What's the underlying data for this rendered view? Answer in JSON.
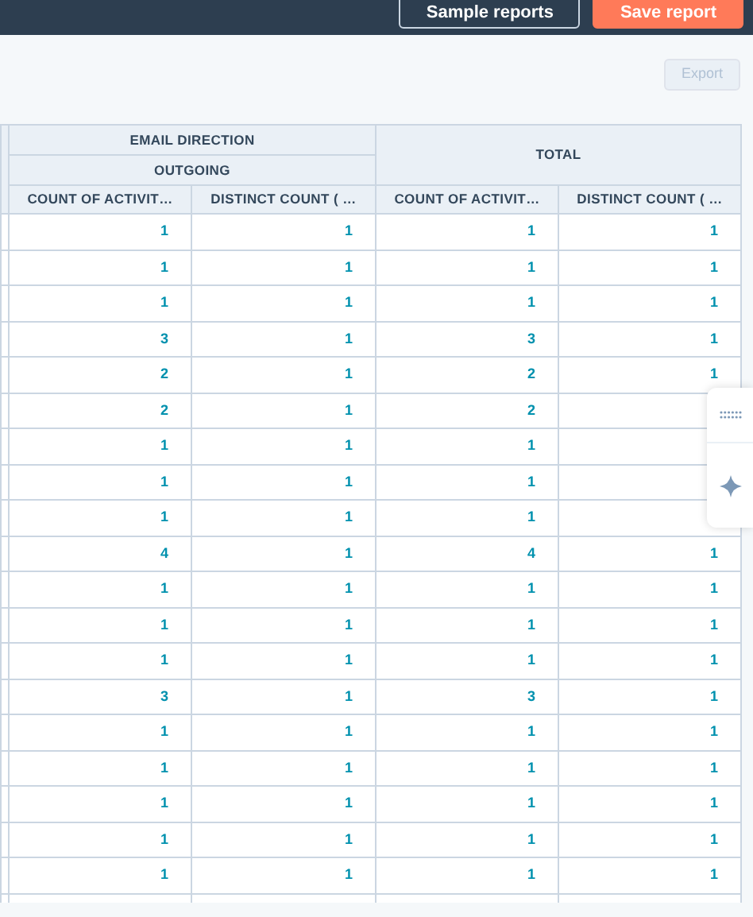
{
  "top_bar": {
    "buttons": [
      {
        "label": "Sample reports",
        "kind": "secondary"
      },
      {
        "label": "Save report",
        "kind": "primary"
      }
    ]
  },
  "export_button": {
    "label": "Export",
    "disabled": true
  },
  "table": {
    "group_header": "EMAIL DIRECTION",
    "sub_header": "OUTGOING",
    "total_header": "TOTAL",
    "columns": [
      "COUNT OF ACTIVIT…",
      "DISTINCT COUNT ( …",
      "COUNT OF ACTIVIT…",
      "DISTINCT COUNT ( …"
    ],
    "rows": [
      [
        "1",
        "1",
        "1",
        "1"
      ],
      [
        "1",
        "1",
        "1",
        "1"
      ],
      [
        "1",
        "1",
        "1",
        "1"
      ],
      [
        "3",
        "1",
        "3",
        "1"
      ],
      [
        "2",
        "1",
        "2",
        "1"
      ],
      [
        "2",
        "1",
        "2"
      ],
      [
        "1",
        "1",
        "1"
      ],
      [
        "1",
        "1",
        "1"
      ],
      [
        "1",
        "1",
        "1"
      ],
      [
        "4",
        "1",
        "4",
        "1"
      ],
      [
        "1",
        "1",
        "1",
        "1"
      ],
      [
        "1",
        "1",
        "1",
        "1"
      ],
      [
        "1",
        "1",
        "1",
        "1"
      ],
      [
        "3",
        "1",
        "3",
        "1"
      ],
      [
        "1",
        "1",
        "1",
        "1"
      ],
      [
        "1",
        "1",
        "1",
        "1"
      ],
      [
        "1",
        "1",
        "1",
        "1"
      ],
      [
        "1",
        "1",
        "1",
        "1"
      ],
      [
        "1",
        "1",
        "1",
        "1"
      ]
    ]
  }
}
